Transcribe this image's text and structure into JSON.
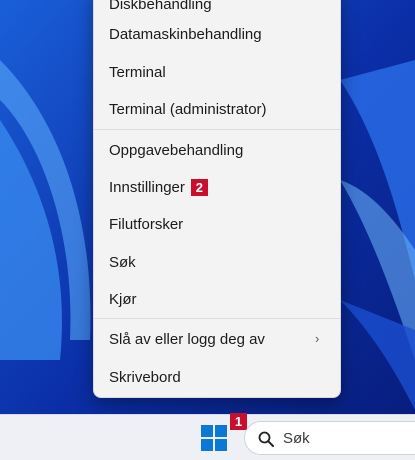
{
  "menu": {
    "items": [
      {
        "label": "Diskbehandling"
      },
      {
        "label": "Datamaskinbehandling"
      },
      {
        "label": "Terminal"
      },
      {
        "label": "Terminal (administrator)"
      },
      {
        "label": "Oppgavebehandling"
      },
      {
        "label": "Innstillinger",
        "badge": "2"
      },
      {
        "label": "Filutforsker"
      },
      {
        "label": "Søk"
      },
      {
        "label": "Kjør"
      },
      {
        "label": "Slå av eller logg deg av",
        "submenu_indicator": "›"
      },
      {
        "label": "Skrivebord"
      }
    ]
  },
  "taskbar": {
    "start_badge": "1",
    "search": {
      "placeholder": "Søk",
      "icon": "search-icon"
    },
    "start_icon": "windows-logo-icon"
  },
  "colors": {
    "badge": "#c8102e",
    "windows_logo": "#0a78d4",
    "wallpaper": "#0a2a9c"
  }
}
